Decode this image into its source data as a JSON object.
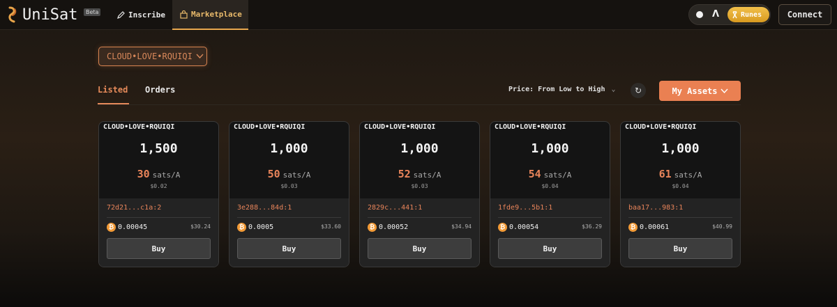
{
  "header": {
    "logo_text": "UniSat",
    "beta_badge": "Beta",
    "nav": [
      {
        "label": "Inscribe",
        "icon": "pencil-icon"
      },
      {
        "label": "Marketplace",
        "icon": "shopping-bag-icon",
        "active": true
      }
    ],
    "network_toggle": {
      "runes_label": "Runes"
    },
    "connect_label": "Connect"
  },
  "market": {
    "token_selector": "CLOUD•LOVE•RQUIQI",
    "tabs": [
      {
        "label": "Listed",
        "active": true
      },
      {
        "label": "Orders",
        "active": false
      }
    ],
    "sort_label": "Price: From Low to High",
    "my_assets_label": "My Assets"
  },
  "listings": [
    {
      "ticker": "CLOUD•LOVE•RQUIQI",
      "amount": "1,500",
      "price": "30",
      "unit": "sats/A",
      "price_usd": "$0.02",
      "utxo": "72d21...c1a:2",
      "btc": "0.00045",
      "btc_usd": "$30.24",
      "buy_label": "Buy"
    },
    {
      "ticker": "CLOUD•LOVE•RQUIQI",
      "amount": "1,000",
      "price": "50",
      "unit": "sats/A",
      "price_usd": "$0.03",
      "utxo": "3e288...84d:1",
      "btc": "0.0005",
      "btc_usd": "$33.60",
      "buy_label": "Buy"
    },
    {
      "ticker": "CLOUD•LOVE•RQUIQI",
      "amount": "1,000",
      "price": "52",
      "unit": "sats/A",
      "price_usd": "$0.03",
      "utxo": "2829c...441:1",
      "btc": "0.00052",
      "btc_usd": "$34.94",
      "buy_label": "Buy"
    },
    {
      "ticker": "CLOUD•LOVE•RQUIQI",
      "amount": "1,000",
      "price": "54",
      "unit": "sats/A",
      "price_usd": "$0.04",
      "utxo": "1fde9...5b1:1",
      "btc": "0.00054",
      "btc_usd": "$36.29",
      "buy_label": "Buy"
    },
    {
      "ticker": "CLOUD•LOVE•RQUIQI",
      "amount": "1,000",
      "price": "61",
      "unit": "sats/A",
      "price_usd": "$0.04",
      "utxo": "baa17...983:1",
      "btc": "0.00061",
      "btc_usd": "$40.99",
      "buy_label": "Buy"
    }
  ],
  "colors": {
    "accent": "#ea8052",
    "nav_active": "#e8b96a",
    "runes_gold": "#f2c04a",
    "btc_orange": "#f29a36"
  }
}
